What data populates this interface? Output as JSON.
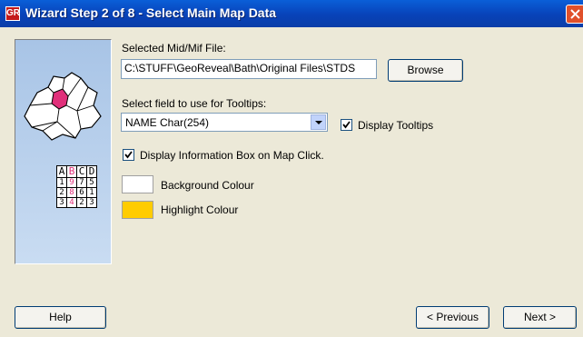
{
  "window": {
    "title": "Wizard Step 2 of 8 - Select Main Map Data",
    "app_icon_text": "GR"
  },
  "file": {
    "label": "Selected Mid/Mif File:",
    "value": "C:\\STUFF\\GeoReveal\\Bath\\Original Files\\STDS",
    "browse_label": "Browse"
  },
  "tooltips": {
    "label": "Select field to use for Tooltips:",
    "selected": "NAME Char(254)",
    "display_label": "Display Tooltips",
    "display_checked": true
  },
  "info_box": {
    "label": "Display Information Box on Map Click.",
    "checked": true
  },
  "colours": {
    "background_label": "Background Colour",
    "background_value": "#ffffff",
    "highlight_label": "Highlight Colour",
    "highlight_value": "#ffcc00"
  },
  "side_grid": {
    "headers": [
      "A",
      "B",
      "C",
      "D"
    ],
    "rows": [
      [
        "1",
        "9",
        "7",
        "5"
      ],
      [
        "2",
        "8",
        "6",
        "1"
      ],
      [
        "3",
        "4",
        "2",
        "3"
      ]
    ]
  },
  "footer": {
    "help_label": "Help",
    "previous_label": "< Previous",
    "next_label": "Next >"
  }
}
